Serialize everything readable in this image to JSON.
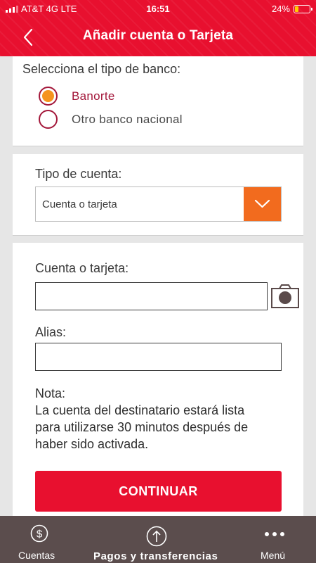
{
  "status_bar": {
    "carrier": "AT&T 4G  LTE",
    "time": "16:51",
    "battery_percent": "24%",
    "battery_level": 0.24,
    "battery_color": "#ffcc00"
  },
  "header": {
    "title": "Añadir cuenta o Tarjeta",
    "back_icon": "chevron-left-icon",
    "color": "#e8102f"
  },
  "bank_type": {
    "label": "Selecciona el tipo de banco:",
    "options": [
      {
        "label": "Banorte",
        "selected": true
      },
      {
        "label": "Otro banco nacional",
        "selected": false
      }
    ],
    "selected_color": "#f5941f"
  },
  "account_type": {
    "label": "Tipo de cuenta:",
    "selected_value": "Cuenta o tarjeta",
    "arrow_icon": "chevron-down-icon",
    "arrow_color": "#f26b1e"
  },
  "form": {
    "account_label": "Cuenta o tarjeta:",
    "account_value": "",
    "camera_icon": "camera-icon",
    "alias_label": "Alias:",
    "alias_value": "",
    "note_title": "Nota:",
    "note_lines": [
      "La cuenta del destinatario estará lista",
      "para utilizarse 30 minutos después de",
      "haber sido activada."
    ],
    "continue_label": "CONTINUAR"
  },
  "tab_bar": {
    "tabs": [
      {
        "label": "Cuentas",
        "icon": "dollar-circle-icon"
      },
      {
        "label": "Pagos y transferencias",
        "icon": "arrow-up-circle-icon"
      },
      {
        "label": "Menú",
        "icon": "more-dots-icon"
      }
    ],
    "background": "#5b4d4d"
  }
}
